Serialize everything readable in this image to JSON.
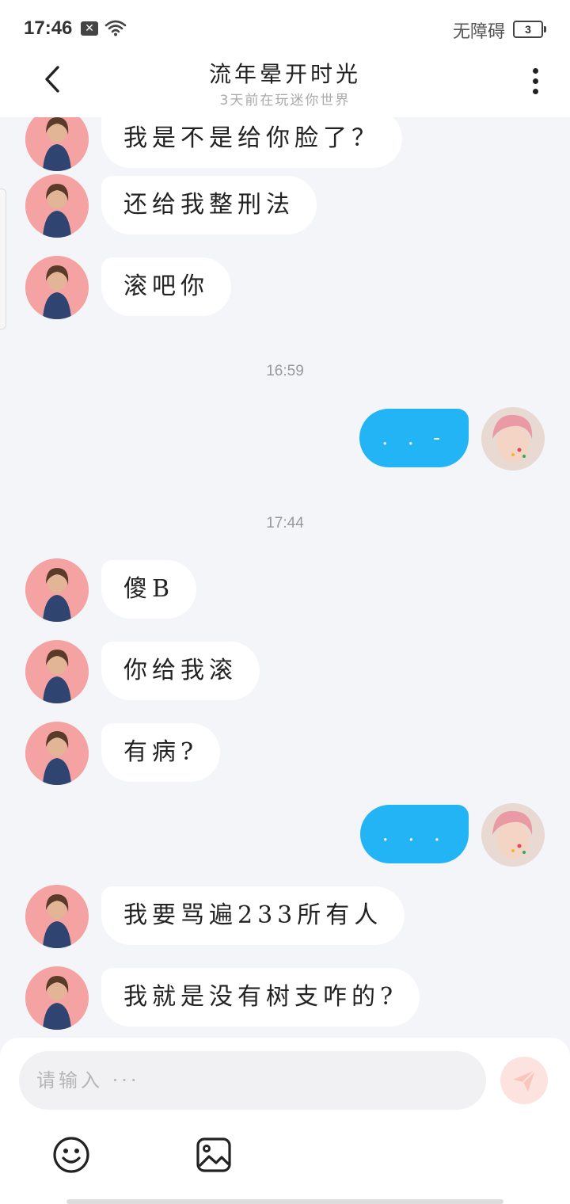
{
  "status_bar": {
    "time": "17:46",
    "notif_icon": "x-box-icon",
    "wifi_icon": "wifi-icon",
    "accessibility": "无障碍",
    "battery": "3"
  },
  "header": {
    "title": "流年晕开时光",
    "subtitle": "3天前在玩迷你世界",
    "back_icon": "back-arrow-icon",
    "more_icon": "more-vertical-icon"
  },
  "messages": [
    {
      "type": "in",
      "text": "我是不是给你脸了？"
    },
    {
      "type": "in",
      "text": "还给我整刑法"
    },
    {
      "type": "in",
      "text": "滚吧你"
    },
    {
      "type": "time",
      "text": "16:59"
    },
    {
      "type": "out",
      "text": ". . -"
    },
    {
      "type": "time",
      "text": "17:44"
    },
    {
      "type": "in",
      "text": "傻B"
    },
    {
      "type": "in",
      "text": "你给我滚"
    },
    {
      "type": "in",
      "text": "有病?"
    },
    {
      "type": "out",
      "text": ". . ."
    },
    {
      "type": "in",
      "text": "我要骂遍233所有人"
    },
    {
      "type": "in",
      "text": "我就是没有树支咋的?"
    }
  ],
  "input": {
    "placeholder": "请输入 ···",
    "value": ""
  },
  "toolbar": {
    "send_icon": "paper-plane-icon",
    "emoji_icon": "smiley-icon",
    "image_icon": "image-icon"
  },
  "colors": {
    "accent": "#22b4f5",
    "background": "#f4f5f9",
    "send_button": "#fde3df"
  }
}
